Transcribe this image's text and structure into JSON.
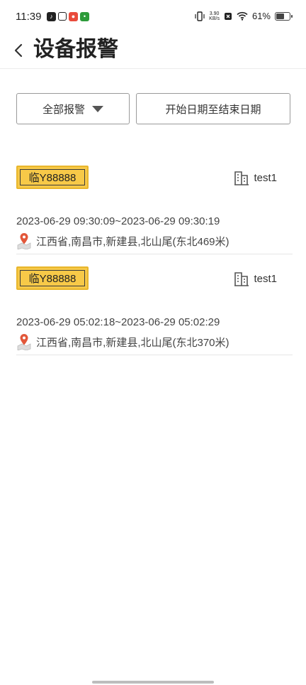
{
  "status_bar": {
    "time": "11:39",
    "network_speed_value": "3.90",
    "network_speed_unit": "KB/s",
    "battery": "61%",
    "battery_level": 0.61
  },
  "header": {
    "title": "设备报警"
  },
  "filters": {
    "alarm_type": "全部报警",
    "date_range": "开始日期至结束日期"
  },
  "alarms": [
    {
      "plate": "临Y88888",
      "owner": "test1",
      "time_range": "2023-06-29 09:30:09~2023-06-29 09:30:19",
      "address": "江西省,南昌市,新建县,北山尾(东北469米)"
    },
    {
      "plate": "临Y88888",
      "owner": "test1",
      "time_range": "2023-06-29 05:02:18~2023-06-29 05:02:29",
      "address": "江西省,南昌市,新建县,北山尾(东北370米)"
    }
  ],
  "colors": {
    "plate_bg": "#f7c948",
    "pin": "#e2573a"
  }
}
